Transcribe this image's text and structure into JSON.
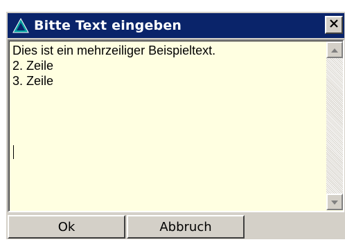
{
  "dialog": {
    "title": "Bitte Text eingeben",
    "title_icon": "triangle-icon",
    "close_icon": "close-icon"
  },
  "editor": {
    "value": "Dies ist ein mehrzeiliger Beispieltext.\n2. Zeile\n3. Zeile\n",
    "background": "#ffffe1"
  },
  "buttons": {
    "ok_label": "Ok",
    "cancel_label": "Abbruch"
  },
  "colors": {
    "titlebar": "#0a246a",
    "face": "#d4d0c8"
  }
}
